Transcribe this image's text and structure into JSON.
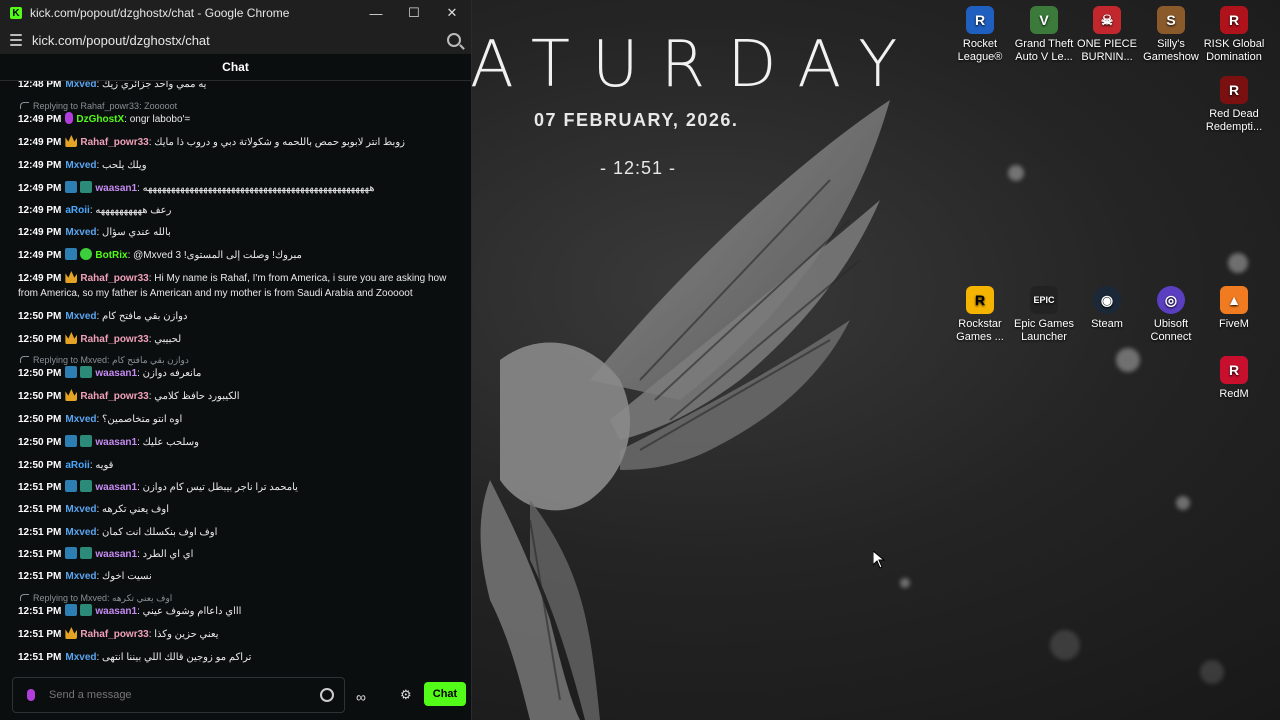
{
  "browser": {
    "title": "kick.com/popout/dzghostx/chat - Google Chrome",
    "url": "kick.com/popout/dzghostx/chat"
  },
  "chat": {
    "header": "Chat",
    "input_placeholder": "Send a message",
    "send_label": "Chat",
    "messages": [
      {
        "time": "12:48 PM",
        "user": "Mxved",
        "text": "يه ممي واحد جزائري زيك"
      },
      {
        "time": "12:49 PM",
        "user": "DzGhostX",
        "text": "ongr labobo'=",
        "reply_to": "Replying to Rahaf_powr33: Zooooot"
      },
      {
        "time": "12:49 PM",
        "user": "Rahaf_powr33",
        "text": "زوبط انتر لابوبو حمص باللحمه و شكولاتة دبي و دروب ذا مايك"
      },
      {
        "time": "12:49 PM",
        "user": "Mxved",
        "text": "ويلك يلحب"
      },
      {
        "time": "12:49 PM",
        "user": "waasan1",
        "text": "هههههههههههههههههههههههههههههههههههههههههههههههههه"
      },
      {
        "time": "12:49 PM",
        "user": "aRoii",
        "text": "رعف ههههههههههه"
      },
      {
        "time": "12:49 PM",
        "user": "Mxved",
        "text": "بالله عندي سؤال"
      },
      {
        "time": "12:49 PM",
        "user": "BotRix",
        "text": "@Mxved 3 !مبروك! وصلت إلى المستوى"
      },
      {
        "time": "12:49 PM",
        "user": "Rahaf_powr33",
        "text": "Hi My name is Rahaf, I'm from America, i sure you are asking how from America, so my father is American and my mother is from Saudi Arabia and Zooooot"
      },
      {
        "time": "12:50 PM",
        "user": "Mxved",
        "text": "دوازن بقي مافتح كام"
      },
      {
        "time": "12:50 PM",
        "user": "Rahaf_powr33",
        "text": "لحبيبي"
      },
      {
        "time": "12:50 PM",
        "user": "waasan1",
        "text": "مانعرفه دوازن",
        "reply_to": "Replying to Mxved: دوازن بقي مافتح كام"
      },
      {
        "time": "12:50 PM",
        "user": "Rahaf_powr33",
        "text": "الكيبورد حافظ كلامي"
      },
      {
        "time": "12:50 PM",
        "user": "Mxved",
        "text": "اوه انتو متخاصمين؟"
      },
      {
        "time": "12:50 PM",
        "user": "waasan1",
        "text": "وسلحب عليك"
      },
      {
        "time": "12:50 PM",
        "user": "aRoii",
        "text": "قويه"
      },
      {
        "time": "12:51 PM",
        "user": "waasan1",
        "text": "يامحمد ترا ناجر بيبطل تيس كام دوازن"
      },
      {
        "time": "12:51 PM",
        "user": "Mxved",
        "text": "اوف يعني تكرهه"
      },
      {
        "time": "12:51 PM",
        "user": "Mxved",
        "text": "اوف اوف بنكسلك انت كمان"
      },
      {
        "time": "12:51 PM",
        "user": "waasan1",
        "text": "اي اي الطرد"
      },
      {
        "time": "12:51 PM",
        "user": "Mxved",
        "text": "نسيت اخوك"
      },
      {
        "time": "12:51 PM",
        "user": "waasan1",
        "text": "اااي داعاام وشوف عيني",
        "reply_to": "Replying to Mxved: اوف يعني تكرهه"
      },
      {
        "time": "12:51 PM",
        "user": "Rahaf_powr33",
        "text": "يعني حزين وكذا"
      },
      {
        "time": "12:51 PM",
        "user": "Mxved",
        "text": "تراكم مو زوجين قالك اللي بيننا انتهى"
      }
    ]
  },
  "colors": {
    "Mxved": "#5aa5f0",
    "DzGhostX": "#53fc18",
    "Rahaf_powr33": "#f0a0b8",
    "waasan1": "#c58bf2",
    "aRoii": "#4aa8ff",
    "BotRix": "#53fc18",
    "kick_green": "#53fc18"
  },
  "wallpaper": {
    "day_word": "ATURDAY",
    "date": "07 FEBRUARY, 2026.",
    "time": "- 12:51 -"
  },
  "desktop_icons": [
    {
      "label": "Rocket League®",
      "icon": "rocket-league-icon"
    },
    {
      "label": "Grand Theft Auto V Le...",
      "icon": "gta-v-icon"
    },
    {
      "label": "ONE PIECE BURNIN...",
      "icon": "one-piece-icon"
    },
    {
      "label": "Silly's Gameshow",
      "icon": "sillys-gameshow-icon"
    },
    {
      "label": "RISK Global Domination",
      "icon": "risk-icon"
    },
    {
      "label": "Red Dead Redempti...",
      "icon": "red-dead-icon"
    },
    {
      "label": "Rockstar Games ...",
      "icon": "rockstar-icon"
    },
    {
      "label": "Epic Games Launcher",
      "icon": "epic-games-icon"
    },
    {
      "label": "Steam",
      "icon": "steam-icon"
    },
    {
      "label": "Ubisoft Connect",
      "icon": "ubisoft-icon"
    },
    {
      "label": "FiveM",
      "icon": "fivem-icon"
    },
    {
      "label": "RedM",
      "icon": "redm-icon"
    }
  ]
}
